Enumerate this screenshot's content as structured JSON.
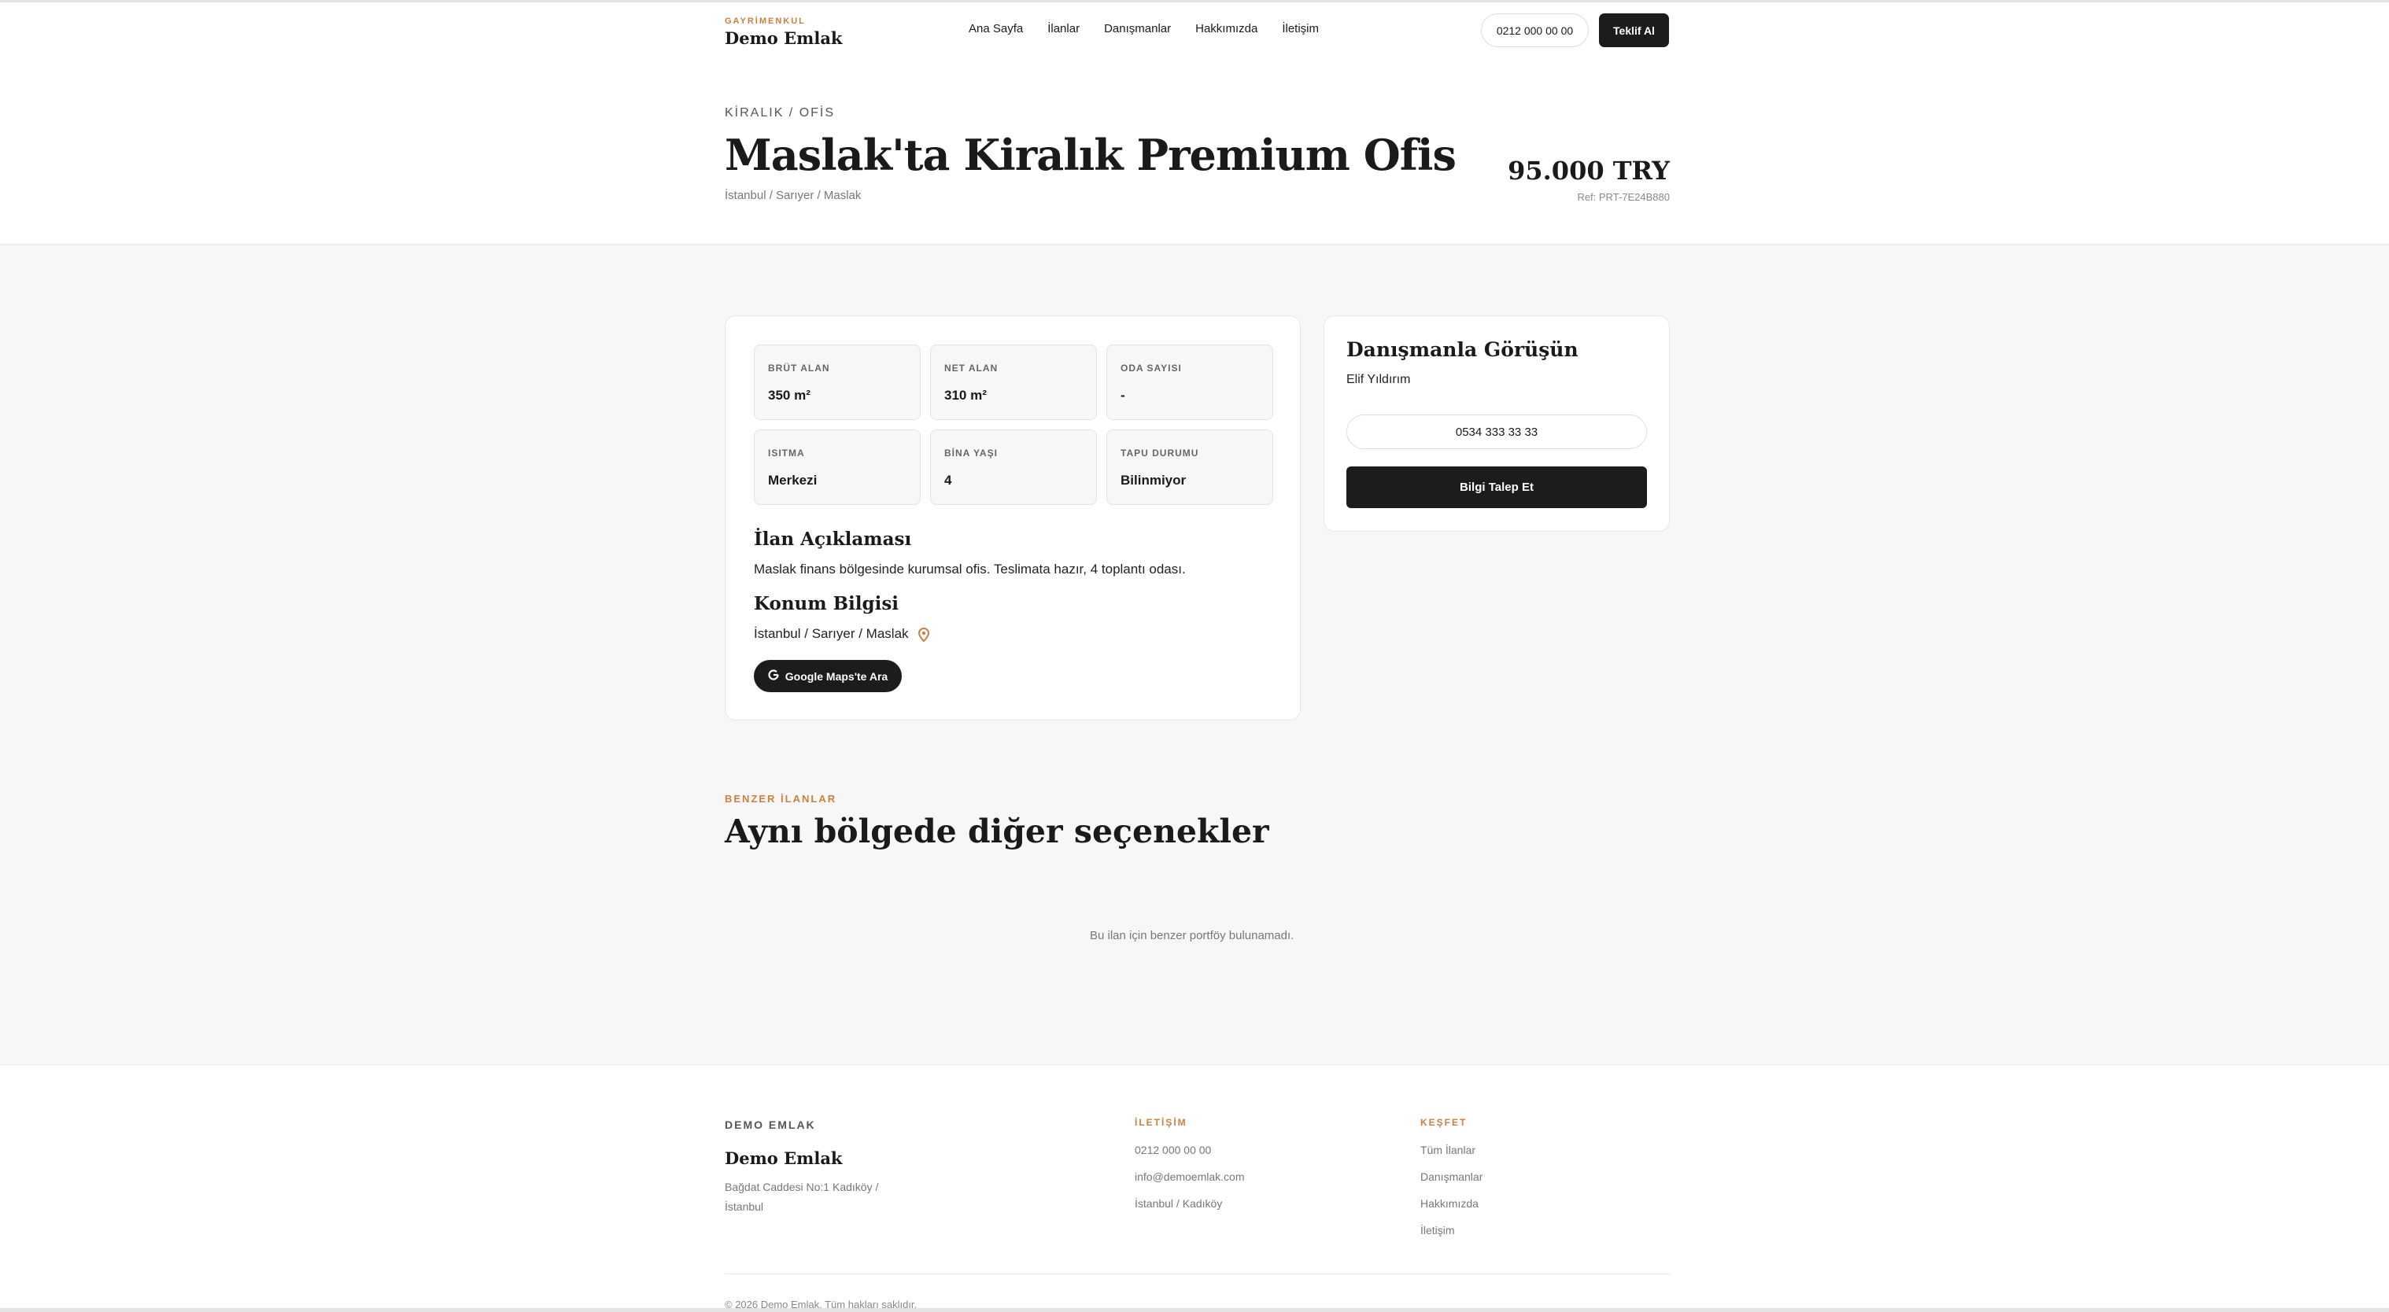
{
  "header": {
    "brand_kicker": "GAYRİMENKUL",
    "brand_name": "Demo Emlak",
    "nav": [
      "Ana Sayfa",
      "İlanlar",
      "Danışmanlar",
      "Hakkımızda",
      "İletişim"
    ],
    "phone": "0212 000 00 00",
    "cta": "Teklif Al"
  },
  "listing": {
    "breadcrumb": "KİRALIK / OFİS",
    "title": "Maslak'ta Kiralık Premium Ofis",
    "location": "İstanbul / Sarıyer / Maslak",
    "price": "95.000 TRY",
    "ref": "Ref: PRT-7E24B880"
  },
  "stats": [
    {
      "label": "BRÜT ALAN",
      "value": "350 m²"
    },
    {
      "label": "NET ALAN",
      "value": "310 m²"
    },
    {
      "label": "ODA SAYISI",
      "value": "-"
    },
    {
      "label": "ISITMA",
      "value": "Merkezi"
    },
    {
      "label": "BİNA YAŞI",
      "value": "4"
    },
    {
      "label": "TAPU DURUMU",
      "value": "Bilinmiyor"
    }
  ],
  "description": {
    "heading": "İlan Açıklaması",
    "text": "Maslak finans bölgesinde kurumsal ofis. Teslimata hazır, 4 toplantı odası."
  },
  "location_info": {
    "heading": "Konum Bilgisi",
    "text": "İstanbul / Sarıyer / Maslak",
    "maps_button": "Google Maps'te Ara",
    "maps_icon": "google-g-icon",
    "pin_icon": "map-pin-icon"
  },
  "agent": {
    "heading": "Danışmanla Görüşün",
    "name": "Elif Yıldırım",
    "phone": "0534 333 33 33",
    "request_button": "Bilgi Talep Et"
  },
  "similar": {
    "kicker": "BENZER İLANLAR",
    "title": "Aynı bölgede diğer seçenekler",
    "empty": "Bu ilan için benzer portföy bulunamadı."
  },
  "footer": {
    "kicker": "DEMO EMLAK",
    "name": "Demo Emlak",
    "address": "Bağdat Caddesi No:1 Kadıköy / İstanbul",
    "contact_heading": "İLETİŞİM",
    "contact": [
      "0212 000 00 00",
      "info@demoemlak.com",
      "İstanbul / Kadıköy"
    ],
    "explore_heading": "KEŞFET",
    "explore": [
      "Tüm İlanlar",
      "Danışmanlar",
      "Hakkımızda",
      "İletişim"
    ],
    "copyright": "© 2026 Demo Emlak. Tüm hakları saklıdır."
  },
  "colors": {
    "accent": "#c9803f",
    "dark": "#1c1c1c",
    "page_bg": "#f7f7f7"
  }
}
